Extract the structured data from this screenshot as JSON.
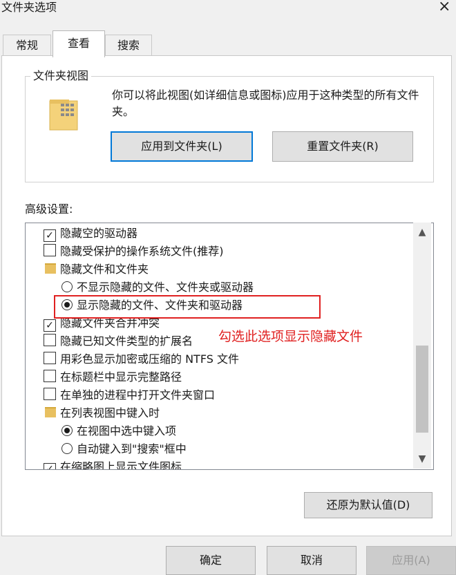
{
  "window": {
    "title": "文件夹选项",
    "close": "×"
  },
  "tabs": [
    "常规",
    "查看",
    "搜索"
  ],
  "folder_view": {
    "legend": "文件夹视图",
    "description": "你可以将此视图(如详细信息或图标)应用于这种类型的所有文件夹。",
    "apply_button": "应用到文件夹(L)",
    "reset_button": "重置文件夹(R)"
  },
  "advanced": {
    "label": "高级设置:",
    "items": [
      {
        "kind": "checkbox",
        "checked": true,
        "label": "隐藏空的驱动器"
      },
      {
        "kind": "checkbox",
        "checked": false,
        "label": "隐藏受保护的操作系统文件(推荐)"
      },
      {
        "kind": "folder",
        "label": "隐藏文件和文件夹"
      },
      {
        "kind": "radio",
        "selected": false,
        "label": "不显示隐藏的文件、文件夹或驱动器"
      },
      {
        "kind": "radio",
        "selected": true,
        "label": "显示隐藏的文件、文件夹和驱动器"
      },
      {
        "kind": "checkbox",
        "checked": true,
        "label": "隐藏文件夹合并冲突"
      },
      {
        "kind": "checkbox",
        "checked": false,
        "label": "隐藏已知文件类型的扩展名"
      },
      {
        "kind": "checkbox",
        "checked": false,
        "label": "用彩色显示加密或压缩的 NTFS 文件"
      },
      {
        "kind": "checkbox",
        "checked": false,
        "label": "在标题栏中显示完整路径"
      },
      {
        "kind": "checkbox",
        "checked": false,
        "label": "在单独的进程中打开文件夹窗口"
      },
      {
        "kind": "folder",
        "label": "在列表视图中键入时"
      },
      {
        "kind": "radio",
        "selected": true,
        "label": "在视图中选中键入项"
      },
      {
        "kind": "radio",
        "selected": false,
        "label": "自动键入到\"搜索\"框中"
      },
      {
        "kind": "checkbox",
        "checked": true,
        "label": "在缩略图上显示文件图标"
      }
    ],
    "scroll_up": "▲",
    "scroll_down": "▼"
  },
  "annotation": "勾选此选项显示隐藏文件",
  "buttons": {
    "restore": "还原为默认值(D)",
    "ok": "确定",
    "cancel": "取消",
    "apply": "应用(A)"
  },
  "icons": {
    "folder_view": "folder-grid-icon",
    "tree_folder": "folder-icon",
    "checkmark": "✓"
  },
  "colors": {
    "highlight": "#e02020",
    "focus": "#0078d7"
  }
}
